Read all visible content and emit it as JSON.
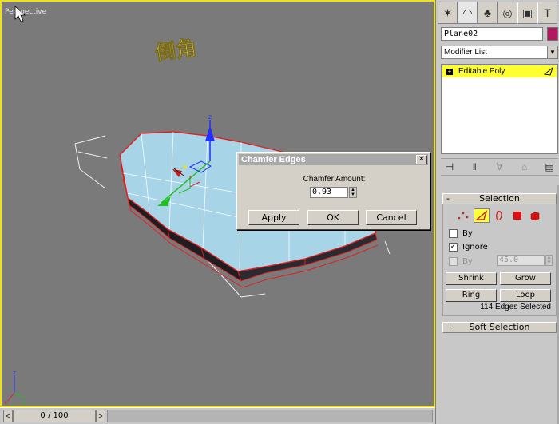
{
  "viewport": {
    "label": "Perspective",
    "annotation": "倒角",
    "axis_labels": {
      "z": "z",
      "x": "x",
      "y": "y"
    }
  },
  "timeline": {
    "frame_display": "0 / 100",
    "prev": "<",
    "next": ">"
  },
  "panel": {
    "tabs": [
      {
        "name": "create-tab",
        "glyph": "✶"
      },
      {
        "name": "modify-tab",
        "glyph": "◠"
      },
      {
        "name": "hierarchy-tab",
        "glyph": "♣"
      },
      {
        "name": "motion-tab",
        "glyph": "◎"
      },
      {
        "name": "display-tab",
        "glyph": "▣"
      },
      {
        "name": "utilities-tab",
        "glyph": "T"
      }
    ],
    "object_name": "Plane02",
    "object_color": "#b01860",
    "modifier_list": "Modifier List",
    "stack_item": "Editable Poly",
    "selection": {
      "title": "Selection",
      "sign": "-",
      "by_vertex_label": "By",
      "ignore_label": "Ignore",
      "by_angle_label": "By",
      "angle_value": "45.0",
      "shrink": "Shrink",
      "grow": "Grow",
      "ring": "Ring",
      "loop": "Loop",
      "status": "114 Edges Selected"
    },
    "soft_selection": {
      "title": "Soft Selection",
      "sign": "+"
    }
  },
  "dialog": {
    "title": "Chamfer Edges",
    "close": "✕",
    "amount_label": "Chamfer Amount:",
    "amount_value": "0.93",
    "apply": "Apply",
    "ok": "OK",
    "cancel": "Cancel"
  },
  "colors": {
    "viewport_border": "#f0e018",
    "viewport_bg": "#7a7a7a",
    "mesh_top": "#a8d4e8",
    "edge_selected": "#e02020",
    "stack_highlight": "#ffff30"
  }
}
